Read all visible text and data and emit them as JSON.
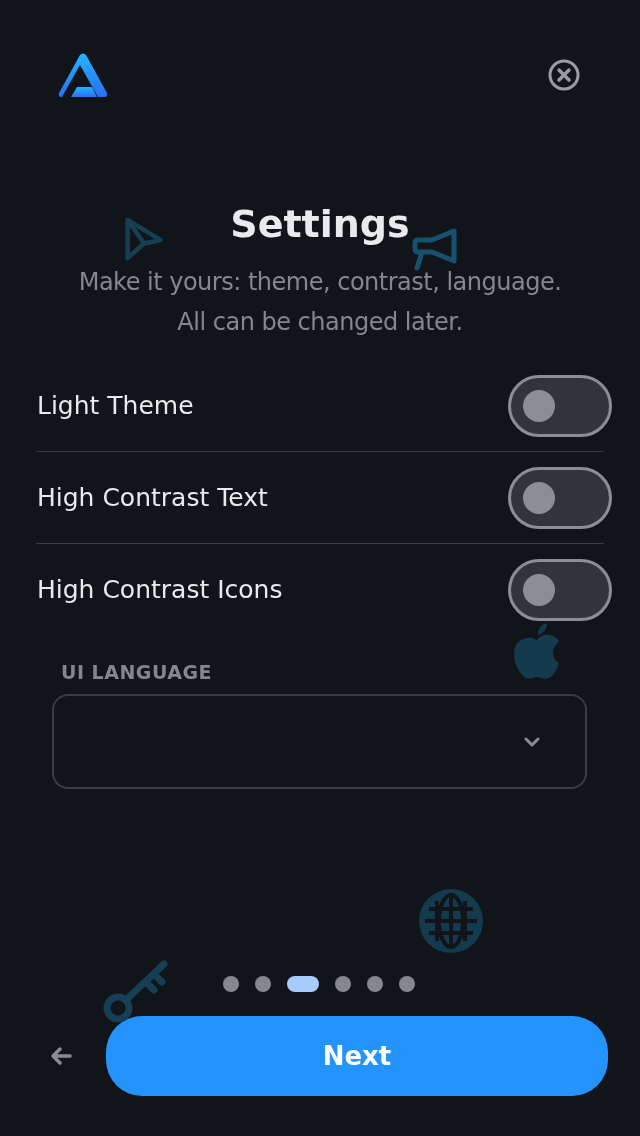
{
  "title": "Settings",
  "subtitle_lines": [
    "Make it yours: theme, contrast, language.",
    "All can be changed later."
  ],
  "settings": [
    {
      "label": "Light Theme",
      "on": false
    },
    {
      "label": "High Contrast Text",
      "on": false
    },
    {
      "label": "High Contrast Icons",
      "on": false
    }
  ],
  "language": {
    "label": "UI LANGUAGE"
  },
  "pages": [
    {
      "selected": false
    },
    {
      "selected": false
    },
    {
      "selected": true
    },
    {
      "selected": false
    },
    {
      "selected": false
    },
    {
      "selected": false
    }
  ],
  "next_button": "Next"
}
